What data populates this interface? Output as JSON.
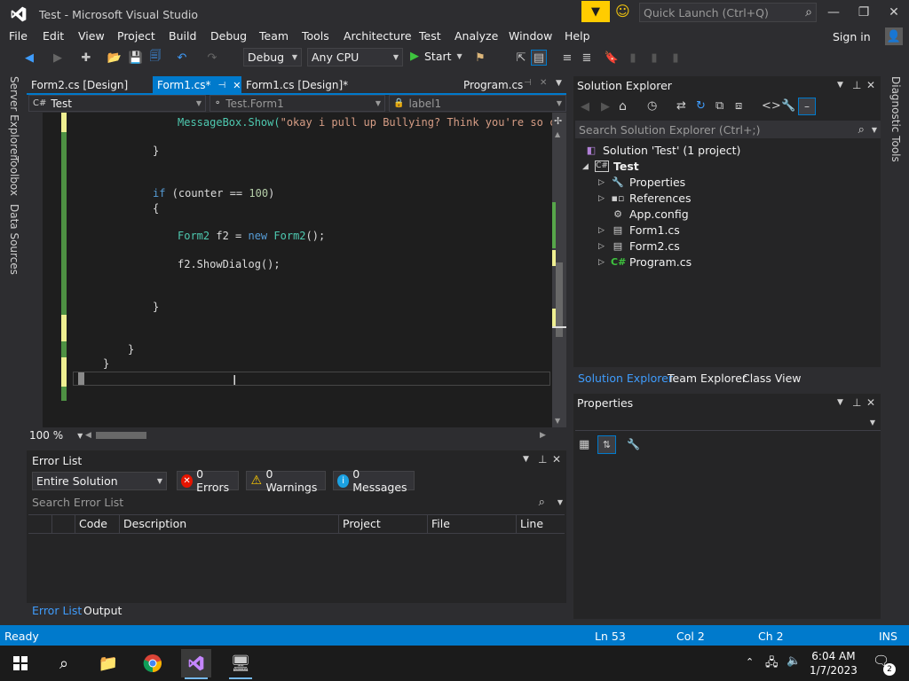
{
  "window": {
    "title": "Test - Microsoft Visual Studio",
    "quick_launch_placeholder": "Quick Launch (Ctrl+Q)",
    "sign_in": "Sign in"
  },
  "menu": [
    "File",
    "Edit",
    "View",
    "Project",
    "Build",
    "Debug",
    "Team",
    "Tools",
    "Architecture",
    "Test",
    "Analyze",
    "Window",
    "Help"
  ],
  "toolbar": {
    "config": "Debug",
    "platform": "Any CPU",
    "start_label": "Start"
  },
  "left_strip": [
    "Server Explorer",
    "Toolbox",
    "Data Sources"
  ],
  "right_strip": [
    "Diagnostic Tools"
  ],
  "doc_tabs": [
    {
      "label": "Form2.cs [Design]",
      "active": false
    },
    {
      "label": "Form1.cs*",
      "active": true
    },
    {
      "label": "Form1.cs [Design]*",
      "active": false
    },
    {
      "label": "Program.cs",
      "active": false
    }
  ],
  "nav": {
    "project": "Test",
    "class": "Test.Form1",
    "member": "label1"
  },
  "code": {
    "line1_call": "MessageBox.Show(",
    "line1_str": "\"okay i pull up Bullying? Think you're so co",
    "brace_close_1": "}",
    "if_kw": "if",
    "if_cond_a": " (counter == ",
    "if_num": "100",
    "if_cond_b": ")",
    "brace_open": "{",
    "decl_type": "Form2",
    "decl_var": " f2 = ",
    "decl_new": "new",
    "decl_ctor": " Form2",
    "decl_end": "();",
    "show": "f2.ShowDialog();",
    "brace_close_2": "}",
    "brace_close_3": "}",
    "brace_close_4": "}"
  },
  "editor": {
    "zoom": "100 %"
  },
  "error_list": {
    "title": "Error List",
    "scope": "Entire Solution",
    "errors": "0 Errors",
    "warnings": "0 Warnings",
    "messages": "0 Messages",
    "search_placeholder": "Search Error List",
    "columns": [
      "Code",
      "Description",
      "Project",
      "File",
      "Line"
    ],
    "tabs": [
      "Error List",
      "Output"
    ]
  },
  "solution_explorer": {
    "title": "Solution Explorer",
    "search_placeholder": "Search Solution Explorer (Ctrl+;)",
    "solution": "Solution 'Test' (1 project)",
    "project": "Test",
    "items": [
      "Properties",
      "References",
      "App.config",
      "Form1.cs",
      "Form2.cs",
      "Program.cs"
    ],
    "tabs": [
      "Solution Explorer",
      "Team Explorer",
      "Class View"
    ]
  },
  "properties": {
    "title": "Properties"
  },
  "status": {
    "state": "Ready",
    "ln": "Ln 53",
    "col": "Col 2",
    "ch": "Ch 2",
    "ins": "INS"
  },
  "taskbar": {
    "time": "6:04 AM",
    "date": "1/7/2023",
    "notifications": "2"
  },
  "colors": {
    "accent": "#007acc",
    "editor_bg": "#1e1e1e",
    "keyword": "#569cd6",
    "type": "#4ec9b0",
    "string": "#d69d85",
    "number": "#b5cea8"
  }
}
